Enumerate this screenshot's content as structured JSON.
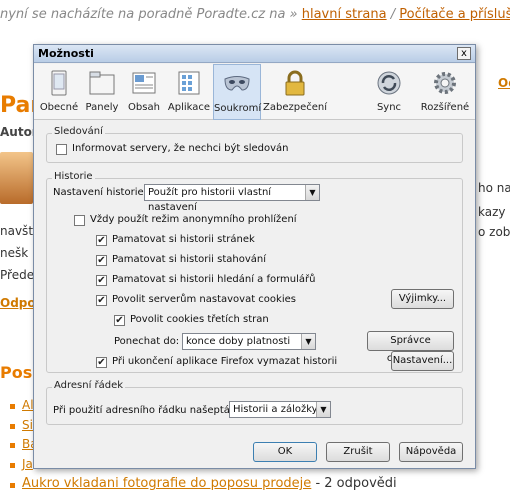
{
  "background": {
    "breadcrumb_prefix": "nyní se nacházíte na poradně Poradte.cz na »",
    "breadcrumb_link1": "hlavní strana",
    "breadcrumb_sep": "/",
    "breadcrumb_link2": "Počítače a příslušen",
    "title_partial": "Par",
    "author_partial": "Autor",
    "right_link_partial": "Od",
    "right_text_1": "ho na",
    "right_text_2": "kazy",
    "right_text_3": "o zobr",
    "left_text_1": "navštív",
    "left_text_2": "nešk",
    "left_text_3": "Přede",
    "left_link": "Odpov",
    "heading_partial": "Posl",
    "list_items": [
      "Al",
      "Si",
      "Ba",
      "Ja"
    ],
    "bottom_link": "Aukro vkladani fotografie do poposu prodeje",
    "bottom_suffix": "- 2 odpovědi"
  },
  "dialog": {
    "title": "Možnosti",
    "close_glyph": "x",
    "tabs": [
      {
        "label": "Obecné"
      },
      {
        "label": "Panely"
      },
      {
        "label": "Obsah"
      },
      {
        "label": "Aplikace"
      },
      {
        "label": "Soukromí"
      },
      {
        "label": "Zabezpečení"
      },
      {
        "label": "Sync"
      },
      {
        "label": "Rozšířené"
      }
    ],
    "selected_tab": "Soukromí",
    "tracking": {
      "group_label": "Sledování",
      "checkbox_label": "Informovat servery, že nechci být sledován",
      "checked": false
    },
    "history": {
      "group_label": "Historie",
      "setting_label": "Nastavení historie:",
      "setting_value": "Použít pro historii vlastní nastavení",
      "private_mode": {
        "label": "Vždy použít režim anonymního prohlížení",
        "checked": false
      },
      "remember_pages": {
        "label": "Pamatovat si historii stránek",
        "checked": true
      },
      "remember_downloads": {
        "label": "Pamatovat si historii stahování",
        "checked": true
      },
      "remember_search": {
        "label": "Pamatovat si historii hledání a formulářů",
        "checked": true
      },
      "accept_cookies": {
        "label": "Povolit serverům nastavovat cookies",
        "checked": true
      },
      "exceptions_button": "Výjimky...",
      "third_party_cookies": {
        "label": "Povolit cookies třetích stran",
        "checked": true
      },
      "keep_until_label": "Ponechat do:",
      "keep_until_value": "konce doby platnosti",
      "cookie_manager_button": "Správce cookies...",
      "clear_on_close": {
        "label": "Při ukončení aplikace Firefox vymazat historii",
        "checked": true
      },
      "settings_button": "Nastavení..."
    },
    "addressbar": {
      "group_label": "Adresní řádek",
      "suggest_label": "Při použití adresního řádku našeptávat:",
      "suggest_value": "Historii a záložky"
    },
    "buttons": {
      "ok": "OK",
      "cancel": "Zrušit",
      "help": "Nápověda"
    },
    "check_glyph": "✔",
    "arrow_glyph": "▼"
  },
  "colors": {
    "accent_orange": "#e87c00",
    "dialog_bg": "#f0f0f0",
    "selected_tab_bg": "#d6e4f5"
  },
  "icons": [
    "general-icon",
    "tabs-icon",
    "content-icon",
    "applications-icon",
    "privacy-mask-icon",
    "security-lock-icon",
    "sync-icon",
    "advanced-gear-icon"
  ]
}
